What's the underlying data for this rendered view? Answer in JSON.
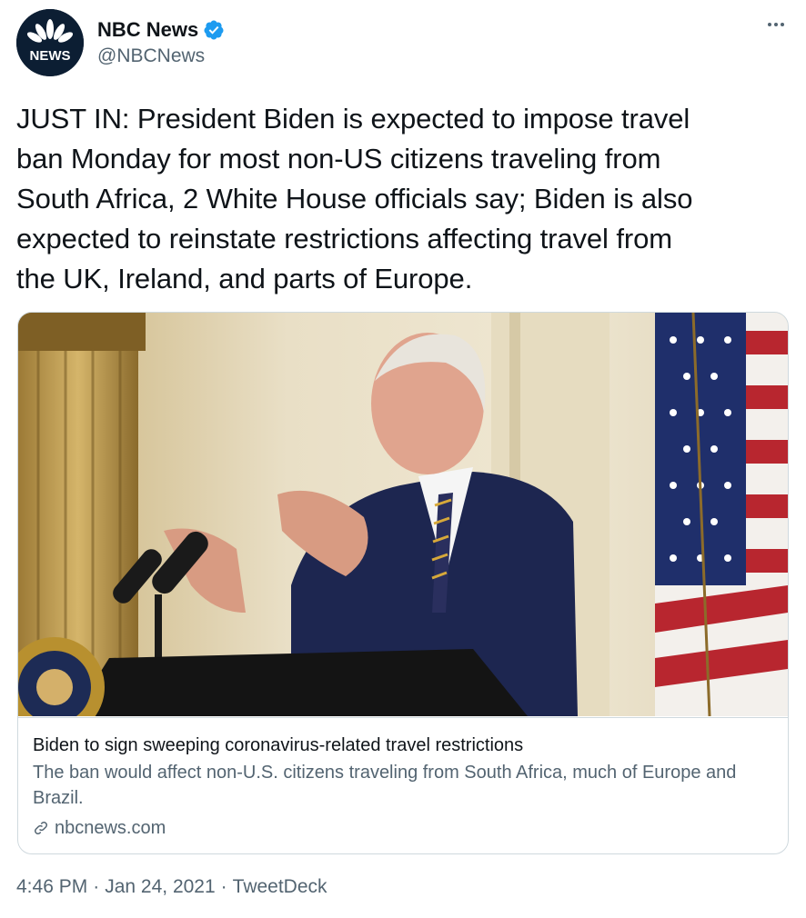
{
  "author": {
    "display_name": "NBC News",
    "handle": "@NBCNews",
    "avatar_label": "NEWS",
    "verified_icon": "verified-badge-icon"
  },
  "tweet": {
    "text": "JUST IN: President Biden is expected to impose travel\nban Monday for most non-US citizens traveling from\nSouth Africa, 2 White House officials say; Biden is also\nexpected to reinstate restrictions affecting travel from\nthe UK, Ireland, and parts of Europe."
  },
  "card": {
    "image_alt": "photo-of-speaker-at-podium",
    "title": "Biden to sign sweeping coronavirus-related travel restrictions",
    "description": "The ban would affect non-U.S. citizens traveling from South Africa, much of Europe and Brazil.",
    "domain": "nbcnews.com",
    "link_icon": "link-icon"
  },
  "meta": {
    "time": "4:46 PM",
    "date": "Jan 24, 2021",
    "separator": "·",
    "source": "TweetDeck"
  },
  "colors": {
    "text": "#0f1419",
    "secondary": "#536471",
    "verified": "#1d9bf0",
    "border": "#cfd9de"
  }
}
